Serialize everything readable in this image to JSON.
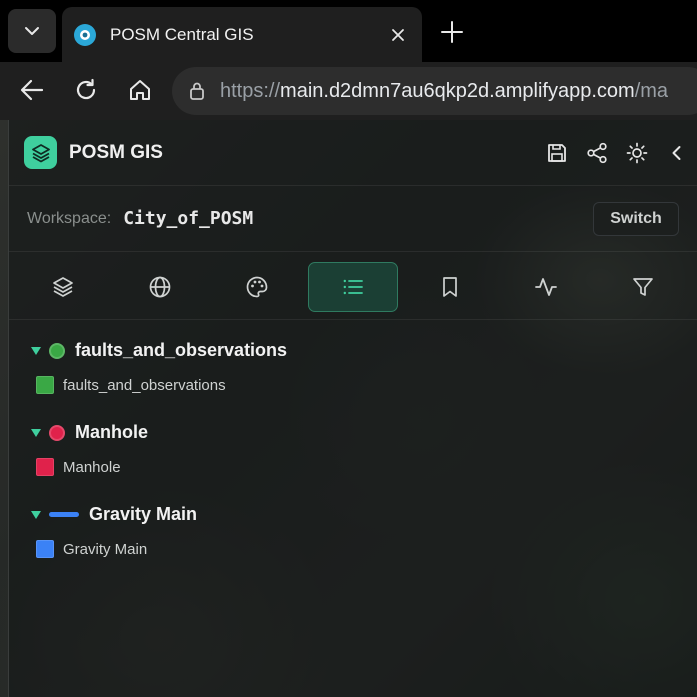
{
  "browser": {
    "tab_title": "POSM Central GIS",
    "url_scheme": "https://",
    "url_host": "main.d2dmn7au6qkp2d.amplifyapp.com",
    "url_path": "/ma"
  },
  "app": {
    "brand": "POSM GIS",
    "accent_color": "#3fcf9e"
  },
  "workspace": {
    "label": "Workspace:",
    "value": "City_of_POSM",
    "switch_label": "Switch"
  },
  "tool_tabs": [
    {
      "icon": "layers-icon"
    },
    {
      "icon": "globe-icon"
    },
    {
      "icon": "palette-icon"
    },
    {
      "icon": "list-icon",
      "active": true
    },
    {
      "icon": "bookmark-icon"
    },
    {
      "icon": "activity-icon"
    },
    {
      "icon": "filter-icon"
    }
  ],
  "layers": [
    {
      "name": "faults_and_observations",
      "legend": "faults_and_observations",
      "symbol": "dot",
      "color": "#3aa845"
    },
    {
      "name": "Manhole",
      "legend": "Manhole",
      "symbol": "dot",
      "color": "#e0224b"
    },
    {
      "name": "Gravity Main",
      "legend": "Gravity Main",
      "symbol": "line",
      "color": "#3b82f6"
    }
  ]
}
